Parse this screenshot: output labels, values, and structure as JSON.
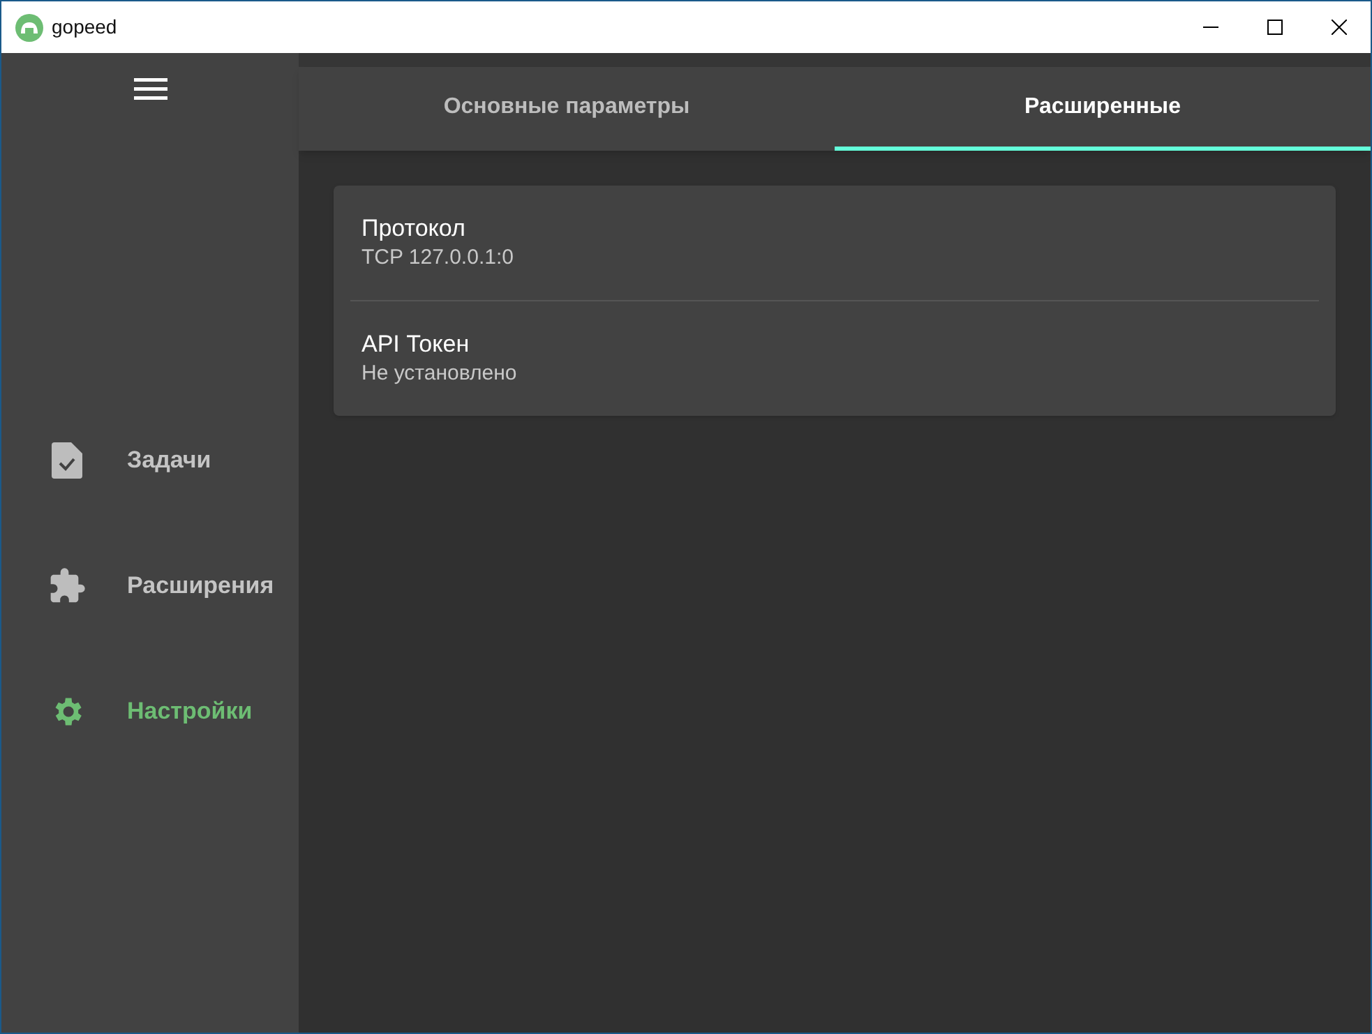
{
  "window": {
    "title": "gopeed"
  },
  "sidebar": {
    "items": [
      {
        "label": "Задачи",
        "selected": false
      },
      {
        "label": "Расширения",
        "selected": false
      },
      {
        "label": "Настройки",
        "selected": true
      }
    ]
  },
  "tabs": [
    {
      "label": "Основные параметры",
      "selected": false
    },
    {
      "label": "Расширенные",
      "selected": true
    }
  ],
  "settings": [
    {
      "title": "Протокол",
      "value": "TCP 127.0.0.1:0"
    },
    {
      "title": "API Токен",
      "value": "Не установлено"
    }
  ]
}
